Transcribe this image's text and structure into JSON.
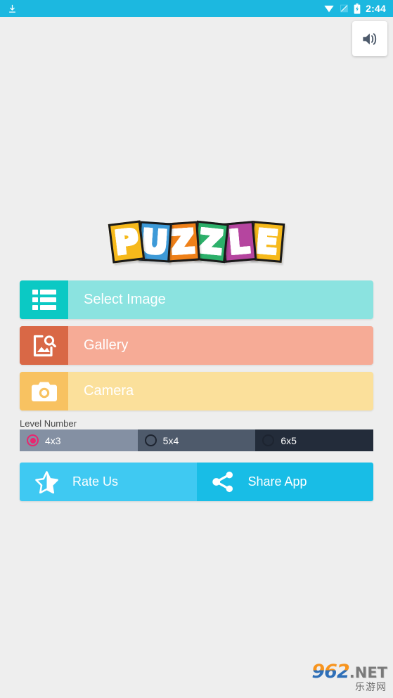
{
  "status_bar": {
    "time": "2:44",
    "left_icons": [
      {
        "name": "download-icon"
      }
    ],
    "right_icons": [
      {
        "name": "wifi-icon"
      },
      {
        "name": "signal-icon"
      },
      {
        "name": "battery-charging-icon"
      }
    ],
    "background": "#1cb8e0"
  },
  "sound_button": {
    "icon": "volume-up-icon",
    "aria_label": "Sound"
  },
  "logo": {
    "text": "PUZZLE",
    "letters": [
      {
        "char": "P",
        "color": "#f6b91b"
      },
      {
        "char": "U",
        "color": "#3d9ad8"
      },
      {
        "char": "Z",
        "color": "#ef8018"
      },
      {
        "char": "Z",
        "color": "#2cb06a"
      },
      {
        "char": "L",
        "color": "#b5459f"
      },
      {
        "char": "E",
        "color": "#f6b91b"
      }
    ]
  },
  "actions": [
    {
      "id": "select-image",
      "label": "Select Image",
      "icon": "list-icon",
      "icon_bg": "#0bc9c4",
      "body_bg": "#8be3e0"
    },
    {
      "id": "gallery",
      "label": "Gallery",
      "icon": "image-search-icon",
      "icon_bg": "#d96846",
      "body_bg": "#f6ab96"
    },
    {
      "id": "camera",
      "label": "Camera",
      "icon": "camera-icon",
      "icon_bg": "#f8c261",
      "body_bg": "#fbe09b"
    }
  ],
  "level_number": {
    "label": "Level Number",
    "selected": "4x3",
    "options": [
      {
        "value": "4x3",
        "selected": true,
        "bg": "#8490a3"
      },
      {
        "value": "5x4",
        "selected": false,
        "bg": "#4e5a6b"
      },
      {
        "value": "6x5",
        "selected": false,
        "bg": "#232c3a"
      }
    ],
    "accent": "#e8266f"
  },
  "bottom_actions": [
    {
      "id": "rate-us",
      "label": "Rate Us",
      "icon": "half-star-icon",
      "bg": "#3fc9f2"
    },
    {
      "id": "share-app",
      "label": "Share App",
      "icon": "share-icon",
      "bg": "#18bde6"
    }
  ],
  "watermark": {
    "primary": "962",
    "suffix": ".NET",
    "subtitle": "乐游网"
  }
}
